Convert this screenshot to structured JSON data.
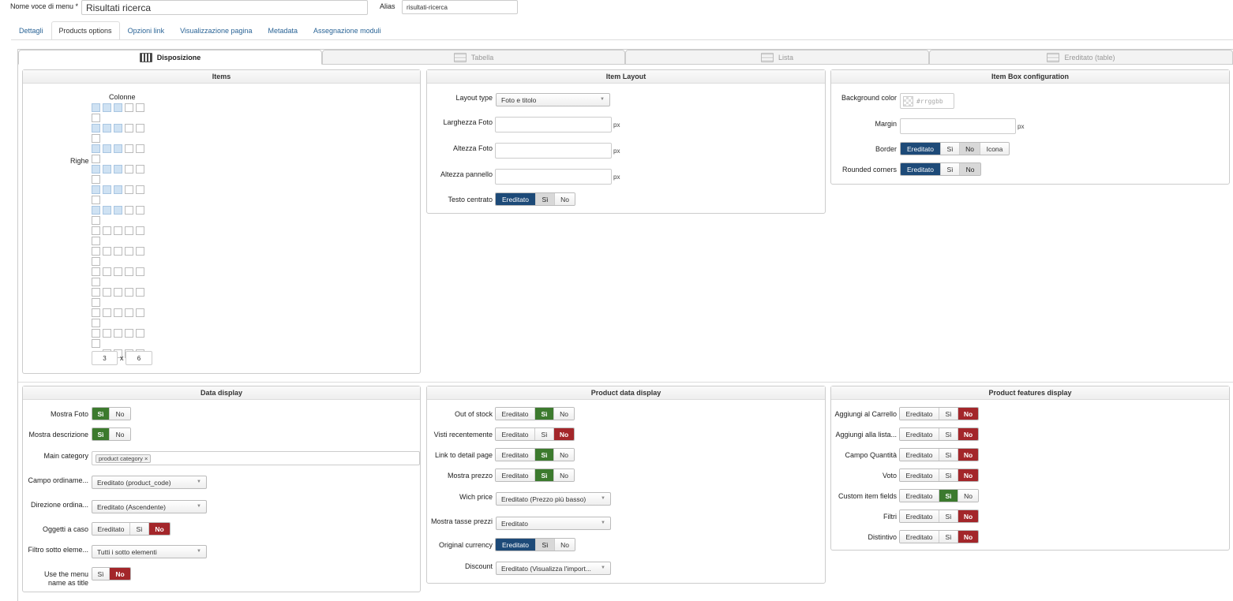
{
  "header": {
    "menu_name_label": "Nome voce di menu *",
    "menu_name_value": "Risultati ricerca",
    "alias_label": "Alias",
    "alias_value": "risultati-ricerca"
  },
  "tabs": [
    "Dettagli",
    "Products options",
    "Opzioni link",
    "Visualizzazione pagina",
    "Metadata",
    "Assegnazione moduli"
  ],
  "active_tab": "Products options",
  "layout_tabs": [
    "Disposizione",
    "Tabella",
    "Lista",
    "Ereditato (table)"
  ],
  "items": {
    "title": "Items",
    "columns_label": "Colonne",
    "rows_label": "Righe",
    "cols_value": "3",
    "times": "x",
    "rows_value": "6"
  },
  "item_layout": {
    "title": "Item Layout",
    "layout_type_label": "Layout type",
    "layout_type_value": "Foto e titolo",
    "photo_width_label": "Larghezza Foto",
    "photo_height_label": "Altezza Foto",
    "panel_height_label": "Altezza pannello",
    "unit": "px",
    "centered_label": "Testo centrato",
    "centered_options": [
      "Ereditato",
      "Sì",
      "No"
    ]
  },
  "item_box": {
    "title": "Item Box configuration",
    "bg_label": "Background color",
    "bg_placeholder": "#rrggbb",
    "margin_label": "Margin",
    "unit": "px",
    "border_label": "Border",
    "border_options": [
      "Ereditato",
      "Sì",
      "No",
      "Icona"
    ],
    "rounded_label": "Rounded corners",
    "rounded_options": [
      "Ereditato",
      "Sì",
      "No"
    ]
  },
  "data_display": {
    "title": "Data display",
    "show_photo_label": "Mostra Foto",
    "show_desc_label": "Mostra descrizione",
    "yes_no": [
      "Sì",
      "No"
    ],
    "main_cat_label": "Main category",
    "main_cat_tag": "product category",
    "order_field_label": "Campo ordiname...",
    "order_field_value": "Ereditato (product_code)",
    "order_dir_label": "Direzione ordina...",
    "order_dir_value": "Ereditato (Ascendente)",
    "random_label": "Oggetti a caso",
    "random_options": [
      "Ereditato",
      "Sì",
      "No"
    ],
    "filter_sub_label": "Filtro sotto eleme...",
    "filter_sub_value": "Tutti i sotto elementi",
    "use_menu_label_1": "Use the menu",
    "use_menu_label_2": "name as title",
    "use_menu_options": [
      "Sì",
      "No"
    ]
  },
  "product_data": {
    "title": "Product data display",
    "rows": [
      {
        "label": "Out of stock",
        "options": [
          "Ereditato",
          "Sì",
          "No"
        ]
      },
      {
        "label": "Visti recentemente",
        "options": [
          "Ereditato",
          "Sì",
          "No"
        ]
      },
      {
        "label": "Link to detail page",
        "options": [
          "Ereditato",
          "Sì",
          "No"
        ]
      },
      {
        "label": "Mostra prezzo",
        "options": [
          "Ereditato",
          "Sì",
          "No"
        ]
      }
    ],
    "wich_price_label": "Wich price",
    "wich_price_value": "Ereditato (Prezzo più basso)",
    "tax_label": "Mostra tasse prezzi",
    "tax_value": "Ereditato",
    "orig_currency_label": "Original currency",
    "orig_currency_options": [
      "Ereditato",
      "Sì",
      "No"
    ],
    "discount_label": "Discount",
    "discount_value": "Ereditato (Visualizza l'import..."
  },
  "product_features": {
    "title": "Product features display",
    "rows": [
      {
        "label": "Aggiungi al Carrello",
        "options": [
          "Ereditato",
          "Sì",
          "No"
        ]
      },
      {
        "label": "Aggiungi alla lista...",
        "options": [
          "Ereditato",
          "Sì",
          "No"
        ]
      },
      {
        "label": "Campo Quantità",
        "options": [
          "Ereditato",
          "Sì",
          "No"
        ]
      },
      {
        "label": "Voto",
        "options": [
          "Ereditato",
          "Sì",
          "No"
        ]
      },
      {
        "label": "Custom item fields",
        "options": [
          "Ereditato",
          "Sì",
          "No"
        ]
      },
      {
        "label": "Filtri",
        "options": [
          "Ereditato",
          "Sì",
          "No"
        ]
      },
      {
        "label": "Distintivo",
        "options": [
          "Ereditato",
          "Sì",
          "No"
        ]
      }
    ]
  },
  "colors": {
    "inherited": "#1d4a78",
    "yes": "#3c7a2e",
    "no": "#a3262a",
    "grid_on": "#cfe2f3"
  }
}
